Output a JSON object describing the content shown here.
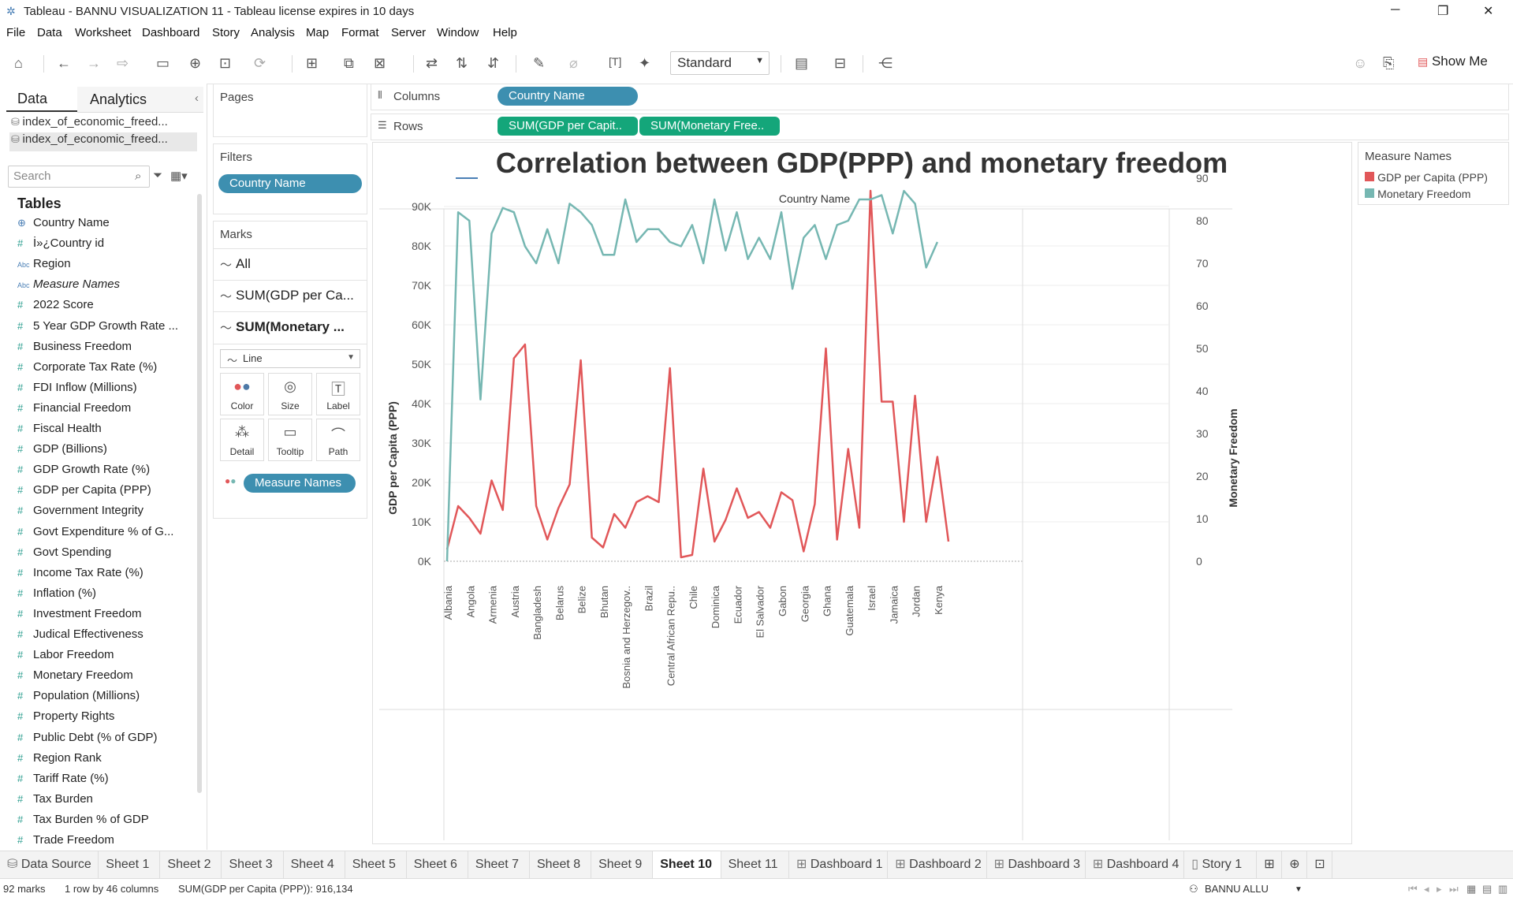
{
  "window": {
    "title": "Tableau - BANNU VISUALIZATION 11 - Tableau license expires in 10 days"
  },
  "menu": [
    "File",
    "Data",
    "Worksheet",
    "Dashboard",
    "Story",
    "Analysis",
    "Map",
    "Format",
    "Server",
    "Window",
    "Help"
  ],
  "toolbar": {
    "mode": "Standard",
    "show_me": "Show Me"
  },
  "left_panel": {
    "tabs": [
      "Data",
      "Analytics"
    ],
    "sources": [
      "index_of_economic_freed...",
      "index_of_economic_freed..."
    ],
    "search_placeholder": "Search",
    "tables_heading": "Tables",
    "fields": [
      {
        "icon": "globe",
        "name": "Country Name"
      },
      {
        "icon": "hash",
        "name": "İ»¿Country id"
      },
      {
        "icon": "abc",
        "name": "Region"
      },
      {
        "icon": "abc",
        "name": "Measure Names",
        "italic": true
      },
      {
        "icon": "hash",
        "name": "2022 Score"
      },
      {
        "icon": "hash",
        "name": "5 Year GDP Growth Rate ..."
      },
      {
        "icon": "hash",
        "name": "Business Freedom"
      },
      {
        "icon": "hash",
        "name": "Corporate Tax Rate (%)"
      },
      {
        "icon": "hash",
        "name": "FDI Inflow (Millions)"
      },
      {
        "icon": "hash",
        "name": "Financial Freedom"
      },
      {
        "icon": "hash",
        "name": "Fiscal Health"
      },
      {
        "icon": "hash",
        "name": "GDP (Billions)"
      },
      {
        "icon": "hash",
        "name": "GDP Growth Rate (%)"
      },
      {
        "icon": "hash",
        "name": "GDP per Capita (PPP)"
      },
      {
        "icon": "hash",
        "name": "Government Integrity"
      },
      {
        "icon": "hash",
        "name": "Govt Expenditure % of G..."
      },
      {
        "icon": "hash",
        "name": "Govt Spending"
      },
      {
        "icon": "hash",
        "name": "Income Tax Rate (%)"
      },
      {
        "icon": "hash",
        "name": "Inflation (%)"
      },
      {
        "icon": "hash",
        "name": "Investment Freedom"
      },
      {
        "icon": "hash",
        "name": "Judical Effectiveness"
      },
      {
        "icon": "hash",
        "name": "Labor Freedom"
      },
      {
        "icon": "hash",
        "name": "Monetary Freedom"
      },
      {
        "icon": "hash",
        "name": "Population (Millions)"
      },
      {
        "icon": "hash",
        "name": "Property Rights"
      },
      {
        "icon": "hash",
        "name": "Public Debt (% of GDP)"
      },
      {
        "icon": "hash",
        "name": "Region Rank"
      },
      {
        "icon": "hash",
        "name": "Tariff Rate (%)"
      },
      {
        "icon": "hash",
        "name": "Tax Burden"
      },
      {
        "icon": "hash",
        "name": "Tax Burden % of GDP"
      },
      {
        "icon": "hash",
        "name": "Trade Freedom"
      }
    ]
  },
  "shelves": {
    "pages": "Pages",
    "filters": "Filters",
    "filter_pill": "Country Name",
    "columns": "Columns",
    "columns_pill": "Country Name",
    "rows": "Rows",
    "rows_pills": [
      "SUM(GDP per Capit..",
      "SUM(Monetary Free.."
    ]
  },
  "marks": {
    "heading": "Marks",
    "items": [
      "All",
      "SUM(GDP per Ca...",
      "SUM(Monetary ..."
    ],
    "mark_type": "Line",
    "cards": [
      "Color",
      "Size",
      "Label",
      "Detail",
      "Tooltip",
      "Path"
    ],
    "color_pill": "Measure Names"
  },
  "legend": {
    "title": "Measure Names",
    "items": [
      {
        "label": "GDP per Capita (PPP)",
        "color": "#e15759"
      },
      {
        "label": "Monetary Freedom",
        "color": "#76b7b2"
      }
    ]
  },
  "chart_data": {
    "type": "line",
    "title": "Correlation between GDP(PPP) and monetary freedom",
    "xlabel": "Country Name",
    "ylabel": "GDP per Capita (PPP)",
    "y2label": "Monetary Freedom",
    "ylim": [
      0,
      98000
    ],
    "y2lim": [
      0,
      91
    ],
    "yticks": [
      "0K",
      "10K",
      "20K",
      "30K",
      "40K",
      "50K",
      "60K",
      "70K",
      "80K",
      "90K"
    ],
    "y2ticks": [
      "0",
      "10",
      "20",
      "30",
      "40",
      "50",
      "60",
      "70",
      "80",
      "90"
    ],
    "tick_labels": [
      "Albania",
      "Angola",
      "Armenia",
      "Austria",
      "Bangladesh",
      "Belarus",
      "Belize",
      "Bhutan",
      "Bosnia and Herzegov..",
      "Brazil",
      "Central African Repu..",
      "Chile",
      "Dominica",
      "Ecuador",
      "El Salvador",
      "Gabon",
      "Georgia",
      "Ghana",
      "Guatemala",
      "Israel",
      "Jamaica",
      "Jordan",
      "Kenya"
    ],
    "points_count": 46,
    "series": [
      {
        "name": "GDP per Capita (PPP)",
        "color": "#e15759",
        "axis": "left",
        "values": [
          3000,
          14000,
          11000,
          7000,
          20500,
          13000,
          51500,
          55000,
          14000,
          5500,
          13500,
          19500,
          51000,
          6000,
          3500,
          12000,
          8500,
          15000,
          16500,
          15000,
          49000,
          1000,
          1600,
          23500,
          5000,
          10500,
          18500,
          11000,
          12500,
          8500,
          17500,
          15500,
          2500,
          14500,
          54000,
          5500,
          28500,
          8500,
          94000,
          40500,
          40500,
          10000,
          42000,
          10000,
          26500,
          5000
        ]
      },
      {
        "name": "Monetary Freedom",
        "color": "#76b7b2",
        "axis": "right",
        "values": [
          0,
          82,
          80,
          38,
          77,
          83,
          82,
          74,
          70,
          78,
          70,
          84,
          82,
          79,
          72,
          72,
          85,
          75,
          78,
          78,
          75,
          74,
          79,
          70,
          85,
          73,
          82,
          71,
          76,
          71,
          82,
          64,
          76,
          79,
          71,
          79,
          80,
          85,
          85,
          86,
          77,
          87,
          84,
          69,
          75
        ]
      }
    ]
  },
  "bottom_tabs": [
    "Data Source",
    "Sheet 1",
    "Sheet 2",
    "Sheet 3",
    "Sheet 4",
    "Sheet 5",
    "Sheet 6",
    "Sheet 7",
    "Sheet 8",
    "Sheet 9",
    "Sheet 10",
    "Sheet 11",
    "Dashboard 1",
    "Dashboard 2",
    "Dashboard 3",
    "Dashboard 4",
    "Story 1"
  ],
  "active_tab": "Sheet 10",
  "status": {
    "marks": "92 marks",
    "dims": "1 row by 46 columns",
    "sum": "SUM(GDP per Capita (PPP)): 916,134",
    "user": "BANNU ALLU"
  }
}
